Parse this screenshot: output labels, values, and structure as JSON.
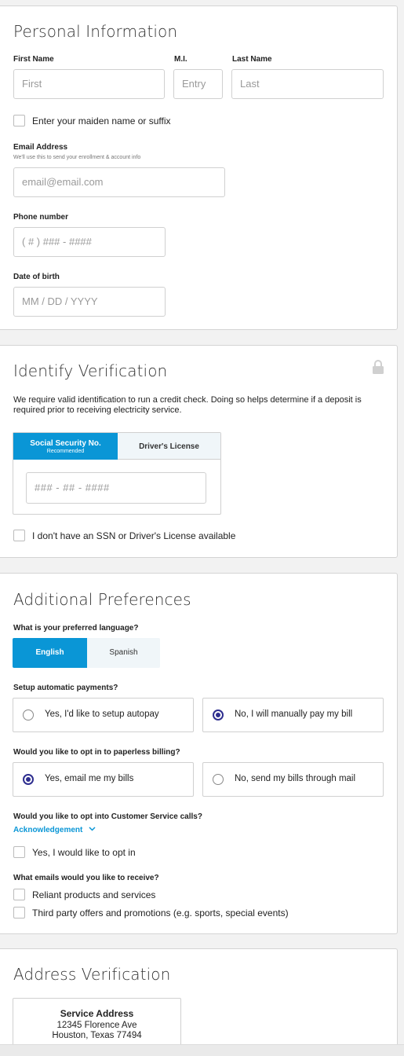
{
  "personal": {
    "title": "Personal Information",
    "first_name_label": "First Name",
    "first_name_placeholder": "First",
    "mi_label": "M.I.",
    "mi_placeholder": "Entry",
    "last_name_label": "Last Name",
    "last_name_placeholder": "Last",
    "maiden_label": "Enter your maiden name or suffix",
    "email_label": "Email Address",
    "email_sub": "We'll use this to send your enrollment & account info",
    "email_placeholder": "email@email.com",
    "phone_label": "Phone number",
    "phone_placeholder": "( # ) ### - ####",
    "dob_label": "Date of birth",
    "dob_placeholder": "MM / DD / YYYY"
  },
  "identify": {
    "title": "Identify Verification",
    "lock_icon": "lock-icon",
    "description": "We require valid identification to run a credit check. Doing so helps determine if a deposit is required prior to receiving electricity service.",
    "tab_ssn": "Social Security No.",
    "tab_ssn_sub": "Recommended",
    "tab_dl": "Driver's License",
    "ssn_placeholder": "### - ## - ####",
    "no_id_label": "I don't have an SSN or Driver's License available"
  },
  "prefs": {
    "title": "Additional Preferences",
    "language_label": "What is your preferred language?",
    "lang_english": "English",
    "lang_spanish": "Spanish",
    "autopay_label": "Setup automatic payments?",
    "autopay_yes": "Yes, I'd like to setup autopay",
    "autopay_no": "No, I will manually pay my bill",
    "paperless_label": "Would you like to opt in to paperless billing?",
    "paperless_yes": "Yes, email me my bills",
    "paperless_no": "No, send my bills through mail",
    "calls_label": "Would you like to opt into Customer Service calls?",
    "ack_link": "Acknowledgement",
    "calls_opt": "Yes, I would like to opt in",
    "emails_label": "What emails would you like to receive?",
    "email_opt1": "Reliant products and services",
    "email_opt2": "Third party offers and promotions (e.g. sports, special events)"
  },
  "address": {
    "title": "Address Verification",
    "service_label": "Service Address",
    "line1": "12345 Florence Ave",
    "line2": "Houston, Texas 77494"
  },
  "colors": {
    "accent": "#0a96d6",
    "radio": "#2e2e8f",
    "tab_bg": "#f0f6f9"
  }
}
